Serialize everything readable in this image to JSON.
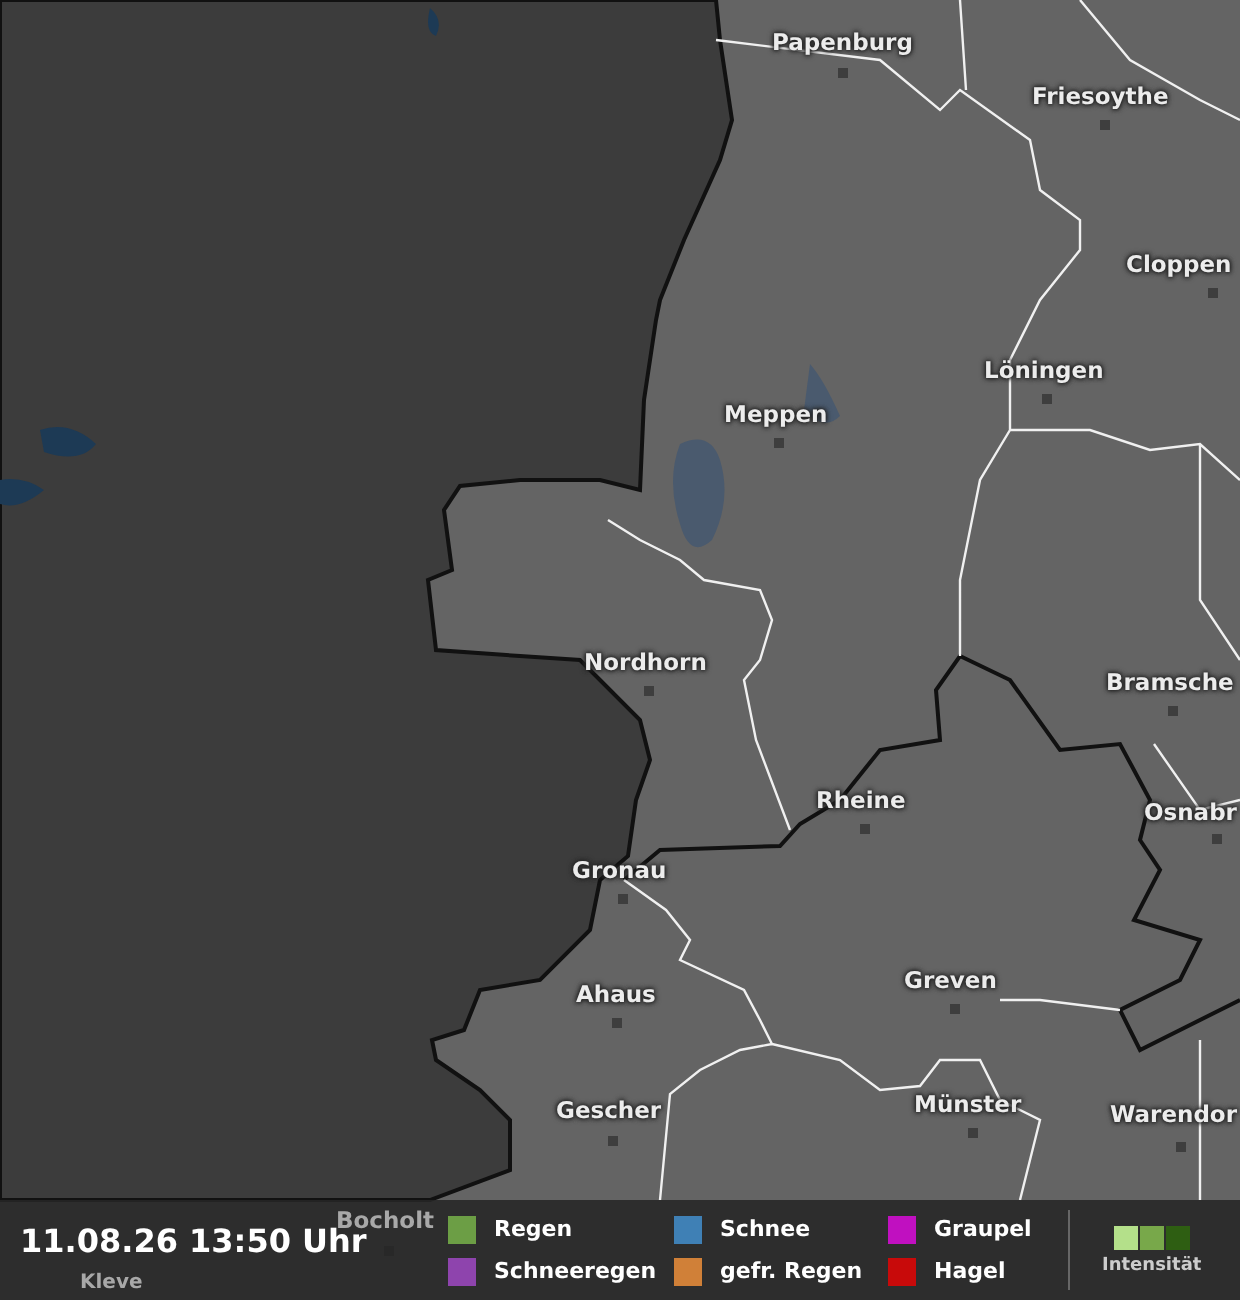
{
  "map": {
    "cities": [
      {
        "name": "Papenburg"
      },
      {
        "name": "Friesoythe"
      },
      {
        "name": "Cloppen"
      },
      {
        "name": "Löningen"
      },
      {
        "name": "Meppen"
      },
      {
        "name": "Nordhorn"
      },
      {
        "name": "Bramsche"
      },
      {
        "name": "Rheine"
      },
      {
        "name": "Osnabr"
      },
      {
        "name": "Gronau"
      },
      {
        "name": "Ahaus"
      },
      {
        "name": "Greven"
      },
      {
        "name": "Gescher"
      },
      {
        "name": "Münster"
      },
      {
        "name": "Warendor"
      },
      {
        "name": "Bocholt"
      },
      {
        "name": "Kleve"
      }
    ]
  },
  "legend": {
    "timestamp": "11.08.26 13:50 Uhr",
    "items": [
      {
        "label": "Regen",
        "color": "#6c9e45"
      },
      {
        "label": "Schneeregen",
        "color": "#8e44ad"
      },
      {
        "label": "Schnee",
        "color": "#3f80b5"
      },
      {
        "label": "gefr. Regen",
        "color": "#d08038"
      },
      {
        "label": "Graupel",
        "color": "#c010c0"
      },
      {
        "label": "Hagel",
        "color": "#c80a0a"
      }
    ],
    "intensity": {
      "label": "Intensität",
      "levels": [
        {
          "color": "#b4e08a"
        },
        {
          "color": "#78a84a"
        },
        {
          "color": "#2e5e12"
        }
      ]
    }
  }
}
